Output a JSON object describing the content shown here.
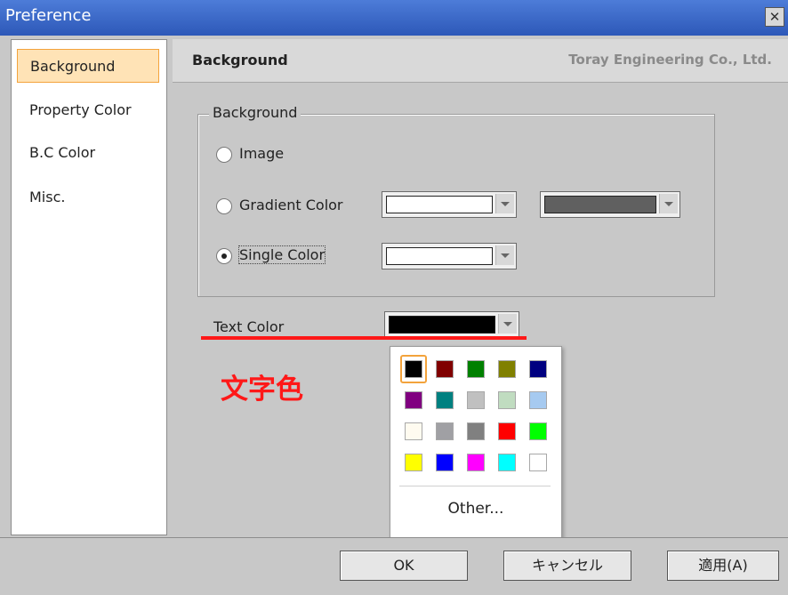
{
  "window": {
    "title": "Preference",
    "close_icon": "close-icon"
  },
  "sidebar": {
    "items": [
      {
        "label": "Background"
      },
      {
        "label": "Property Color"
      },
      {
        "label": "B.C Color"
      },
      {
        "label": "Misc."
      }
    ]
  },
  "header": {
    "title": "Background",
    "company": "Toray Engineering Co., Ltd."
  },
  "background_group": {
    "legend": "Background",
    "options": [
      {
        "label": "Image",
        "checked": false
      },
      {
        "label": "Gradient Color",
        "checked": false
      },
      {
        "label": "Single Color",
        "checked": true
      }
    ],
    "gradient_color_1": "#ffffff",
    "gradient_color_2": "#606060",
    "single_color": "#ffffff"
  },
  "text_color": {
    "label": "Text Color",
    "value": "#000000"
  },
  "annotation": {
    "text": "文字色",
    "color": "#ff1818"
  },
  "color_popup": {
    "colors": [
      [
        "#000000",
        "#800000",
        "#008000",
        "#808000",
        "#000080"
      ],
      [
        "#800080",
        "#008080",
        "#c0c0c0",
        "#c0dcc0",
        "#a6caf0"
      ],
      [
        "#fffbf0",
        "#a0a0a4",
        "#808080",
        "#ff0000",
        "#00ff00"
      ],
      [
        "#ffff00",
        "#0000ff",
        "#ff00ff",
        "#00ffff",
        "#ffffff"
      ]
    ],
    "selected": "#000000",
    "other_label": "Other..."
  },
  "buttons": {
    "ok": "OK",
    "cancel": "キャンセル",
    "apply": "適用(A)"
  }
}
